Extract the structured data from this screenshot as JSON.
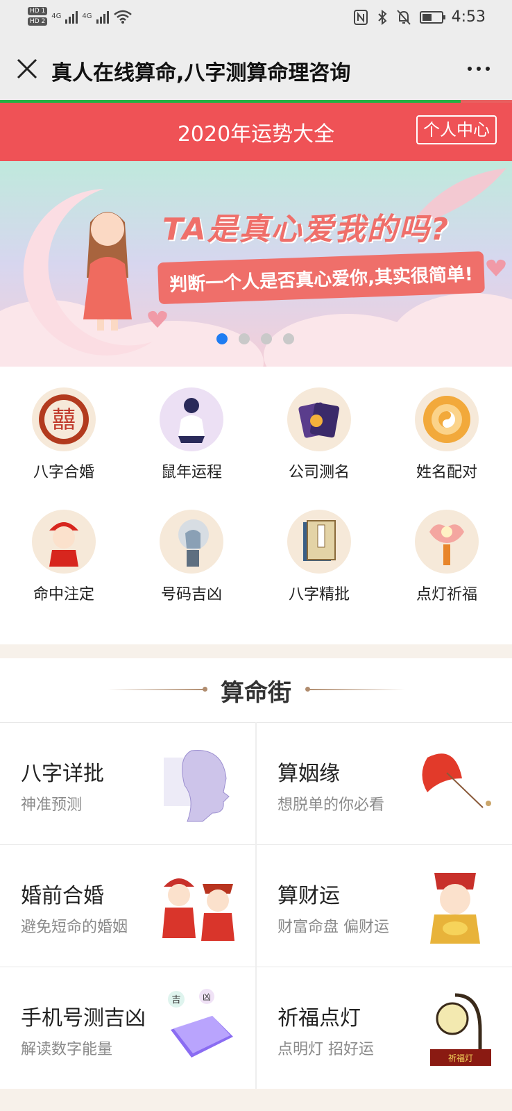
{
  "status_bar": {
    "hd1": "HD 1",
    "hd2": "HD 2",
    "net1": "4G",
    "net2": "4G",
    "battery_level": 0.5,
    "time": "4:53"
  },
  "title_bar": {
    "title": "真人在线算命,八字测算命理咨询",
    "close_icon": "close-icon",
    "more_icon": "more-icon"
  },
  "page_progress": 0.9,
  "header": {
    "title": "2020年运势大全",
    "user_center": "个人中心",
    "accent_color": "#ef5256"
  },
  "banner": {
    "headline": "TA是真心爱我的吗?",
    "subline": "判断一个人是否真心爱你,其实很简单!",
    "slide_count": 4,
    "active_slide": 1
  },
  "grid": {
    "items": [
      {
        "label": "八字合婚",
        "icon": "double-happiness-icon"
      },
      {
        "label": "鼠年运程",
        "icon": "sitting-person-icon"
      },
      {
        "label": "公司测名",
        "icon": "cards-icon"
      },
      {
        "label": "姓名配对",
        "icon": "bagua-icon"
      },
      {
        "label": "命中注定",
        "icon": "bride-icon"
      },
      {
        "label": "号码吉凶",
        "icon": "robot-icon"
      },
      {
        "label": "八字精批",
        "icon": "book-icon"
      },
      {
        "label": "点灯祈福",
        "icon": "lotus-lamp-icon"
      }
    ]
  },
  "section": {
    "title": "算命街",
    "cards": [
      {
        "title": "八字详批",
        "subtitle": "神准预测",
        "icon": "face-scan-icon"
      },
      {
        "title": "算姻缘",
        "subtitle": "想脱单的你必看",
        "icon": "umbrella-icon"
      },
      {
        "title": "婚前合婚",
        "subtitle": "避免短命的婚姻",
        "icon": "couple-icon"
      },
      {
        "title": "算财运",
        "subtitle": "财富命盘 偏财运",
        "icon": "fortune-god-icon"
      },
      {
        "title": "手机号测吉凶",
        "subtitle": "解读数字能量",
        "icon": "phone-icon"
      },
      {
        "title": "祈福点灯",
        "subtitle": "点明灯 招好运",
        "icon": "lamp-icon",
        "lamp_label": "祈福灯"
      }
    ],
    "phone_tags": [
      "吉",
      "凶"
    ]
  }
}
